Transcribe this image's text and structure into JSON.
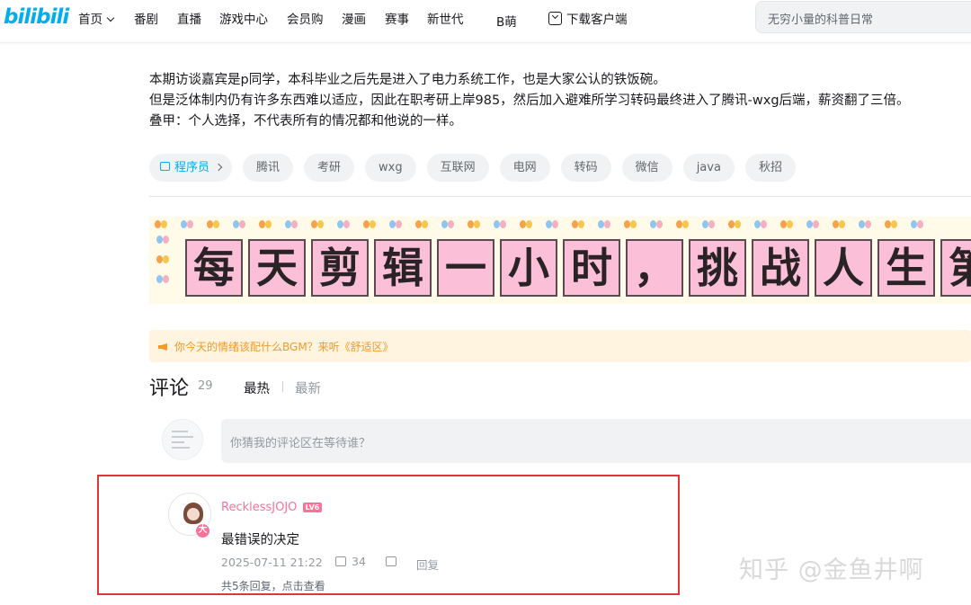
{
  "header": {
    "logo": "bilibili",
    "nav": {
      "home": "首页",
      "bangumi": "番剧",
      "live": "直播",
      "game": "游戏中心",
      "vip": "会员购",
      "manga": "漫画",
      "match": "赛事",
      "newgen": "新世代",
      "bmeng": "B萌",
      "download": "下载客户端"
    },
    "search_placeholder": "无穷小量的科普日常"
  },
  "video": {
    "desc_lines": [
      "本期访谈嘉宾是p同学，本科毕业之后先是进入了电力系统工作，也是大家公认的铁饭碗。",
      "但是泛体制内仍有许多东西难以适应，因此在职考研上岸985，然后加入避难所学习转码最终进入了腾讯-wxg后端，薪资翻了三倍。",
      "叠甲：个人选择，不代表所有的情况都和他说的一样。"
    ],
    "topic_tag": "程序员",
    "tags": [
      "腾讯",
      "考研",
      "wxg",
      "互联网",
      "电网",
      "转码",
      "微信",
      "java",
      "秋招"
    ],
    "banner_chars": [
      "每",
      "天",
      "剪",
      "辑",
      "一",
      "小",
      "时",
      "，",
      "挑",
      "战",
      "人",
      "生",
      "第"
    ]
  },
  "notice": {
    "text": "你今天的情绪该配什么BGM？来听《舒适区》",
    "color": "#f39a2b"
  },
  "comments": {
    "title": "评论",
    "count": "29",
    "sort_hot": "最热",
    "sort_new": "最新",
    "input_placeholder": "你猜我的评论区在等待谁？",
    "item": {
      "username": "RecklessJOJO",
      "level": "LV6",
      "badge": "大",
      "text": "最错误的决定",
      "time": "2025-07-11 21:22",
      "likes": "34",
      "reply_label": "回复",
      "sub_replies": "共5条回复，点击查看"
    }
  },
  "watermark": "知乎 @金鱼井啊",
  "colors": {
    "brand": "#00aeec",
    "pink": "#fb7299",
    "highlight_border": "#e0353a"
  }
}
